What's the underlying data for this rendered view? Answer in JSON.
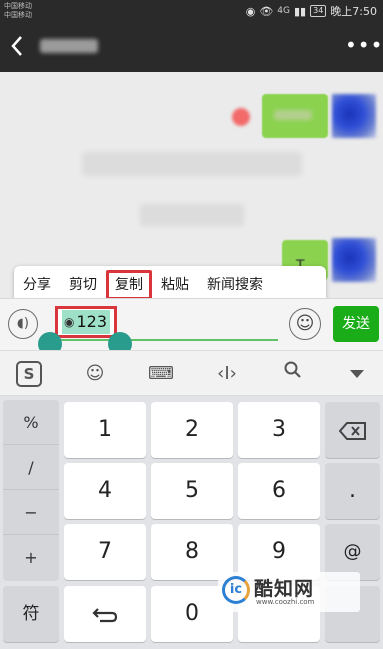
{
  "status_bar": {
    "carrier_1": "中国移动",
    "carrier_2": "中国移动",
    "signal_label": "4G",
    "battery": "34",
    "time": "晚上7:50"
  },
  "title_bar": {
    "back_icon": "chevron-left-icon",
    "more_icon": "more-dots-icon",
    "more_text": "•••"
  },
  "chat": {
    "partial_message_char": "T"
  },
  "context_menu": {
    "items": [
      "分享",
      "剪切",
      "复制",
      "粘贴",
      "新闻搜索"
    ],
    "highlighted": "复制"
  },
  "input": {
    "value": "123",
    "prefix_icon": "eye-icon",
    "send_label": "发送"
  },
  "ime_toolbar": {
    "logo_text": "S",
    "tools": [
      "sogou-logo-icon",
      "emoji-icon",
      "keyboard-icon",
      "cursor-move-icon",
      "search-icon",
      "collapse-icon"
    ]
  },
  "keyboard": {
    "symbols": [
      "%",
      "/",
      "−",
      "+"
    ],
    "digits": [
      "1",
      "2",
      "3",
      "4",
      "5",
      "6",
      "7",
      "8",
      "9",
      "0"
    ],
    "dot": ".",
    "at": "@",
    "symbol_key": "符",
    "backspace_icon": "backspace-icon",
    "return_icon": "return-icon"
  },
  "watermark": {
    "name": "酷知网",
    "url": "www.coozhi.com",
    "logo_text": "ic"
  },
  "colors": {
    "accent_green": "#1aad19",
    "highlight_red": "#d8363c",
    "selection": "#9fe0c8",
    "handle": "#2a9c8d"
  }
}
